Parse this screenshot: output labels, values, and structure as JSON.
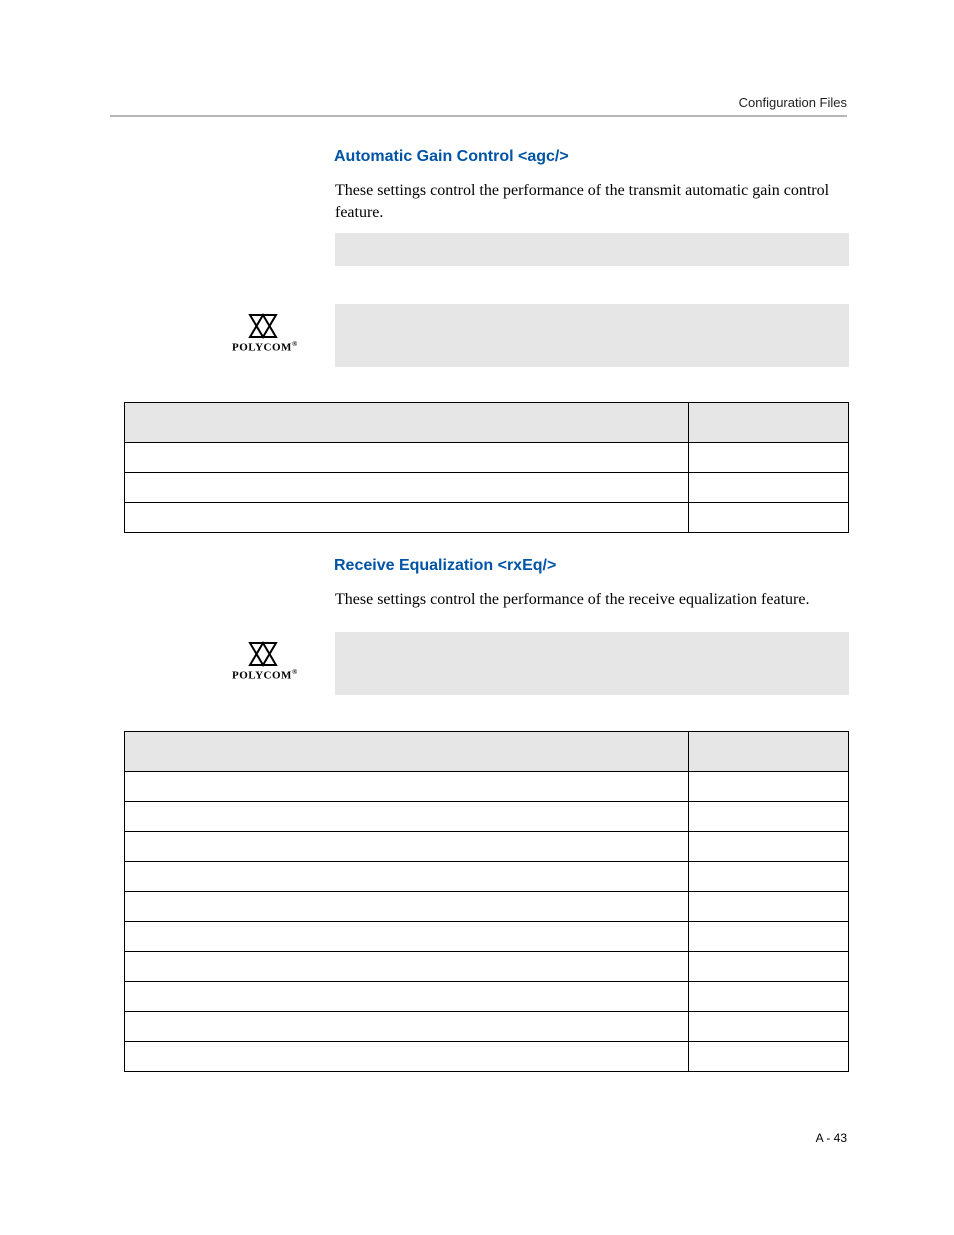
{
  "header": {
    "right_text": "Configuration Files"
  },
  "section1": {
    "title": "Automatic Gain Control <agc/>",
    "body": "These settings control the performance of the transmit automatic gain control feature."
  },
  "section2": {
    "title": "Receive Equalization <rxEq/>",
    "body": "These settings control the performance of the receive equalization feature."
  },
  "logo": {
    "brand": "POLYCOM",
    "reg": "®"
  },
  "footer": {
    "page": "A - 43"
  }
}
